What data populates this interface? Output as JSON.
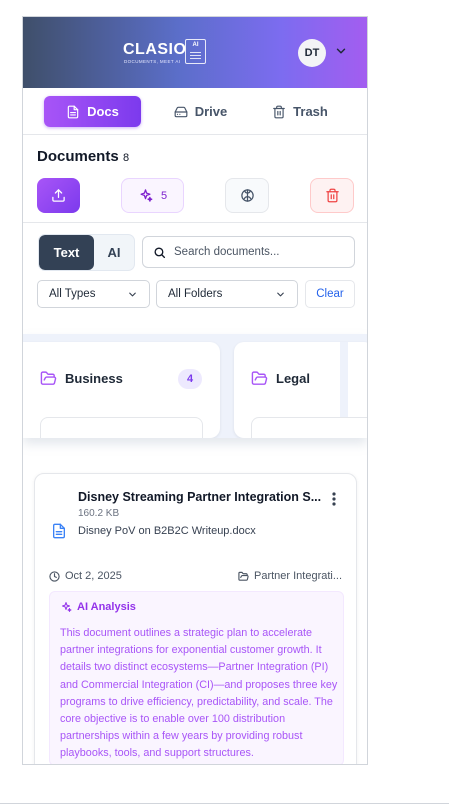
{
  "app": {
    "logo_word": "CLASIO",
    "logo_badge": "AI",
    "logo_tagline": "DOCUMENTS, MEET AI",
    "user_initials": "DT"
  },
  "tabs": [
    {
      "label": "Docs",
      "icon": "file-text-icon",
      "active": true
    },
    {
      "label": "Drive",
      "icon": "hard-drive-icon",
      "active": false
    },
    {
      "label": "Trash",
      "icon": "trash-icon",
      "active": false
    }
  ],
  "documents": {
    "title": "Documents",
    "count": "8",
    "ai_count": "5"
  },
  "search": {
    "mode_text": "Text",
    "mode_ai": "AI",
    "active_mode": "Text",
    "placeholder": "Search documents..."
  },
  "filters": {
    "type_value": "All Types",
    "folder_value": "All Folders",
    "clear_label": "Clear"
  },
  "folders": [
    {
      "name": "Business",
      "count": "4"
    },
    {
      "name": "Legal",
      "count": ""
    }
  ],
  "doc": {
    "title": "Disney Streaming Partner Integration S...",
    "size": "160.2 KB",
    "filename": "Disney PoV on B2B2C Writeup.docx",
    "date": "Oct 2, 2025",
    "folder": "Partner Integrati...",
    "ai_label": "AI Analysis",
    "ai_summary": "This document outlines a strategic plan to accelerate partner integrations for exponential customer growth. It details two distinct ecosystems—Partner Integration (PI) and Commercial Integration (CI)—and proposes three key programs to drive efficiency, predictability, and scale. The core objective is to enable over 100 distribution partnerships within a few years by providing robust playbooks, tools, and support structures."
  },
  "colors": {
    "accent_purple": "#7c3aed",
    "header_gradient_start": "#3f4f6a",
    "header_gradient_end": "#a35df0",
    "danger": "#ef4444",
    "link_blue": "#2563eb"
  }
}
